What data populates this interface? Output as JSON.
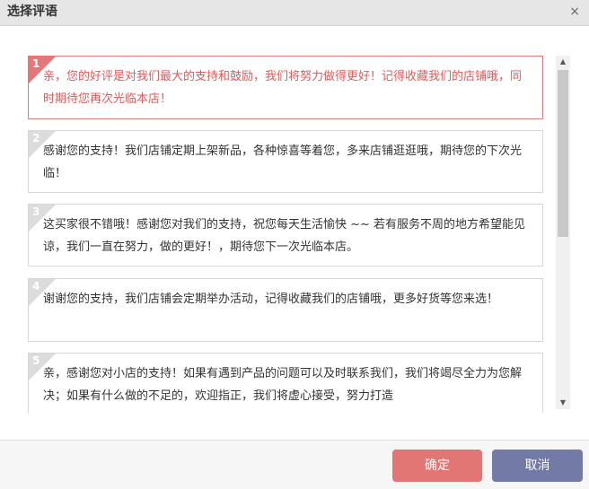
{
  "dialog": {
    "title": "选择评语",
    "close_icon": "×"
  },
  "comments": [
    {
      "num": "1",
      "text": "亲，您的好评是对我们最大的支持和鼓励，我们将努力做得更好！记得收藏我们的店铺哦，同时期待您再次光临本店！",
      "selected": true
    },
    {
      "num": "2",
      "text": "感谢您的支持！我们店铺定期上架新品，各种惊喜等着您，多来店铺逛逛哦，期待您的下次光临！",
      "selected": false
    },
    {
      "num": "3",
      "text": "这买家很不错哦！感谢您对我们的支持，祝您每天生活愉快 ~~ 若有服务不周的地方希望能见谅，我们一直在努力，做的更好！，期待您下一次光临本店。",
      "selected": false
    },
    {
      "num": "4",
      "text": "谢谢您的支持，我们店铺会定期举办活动，记得收藏我们的店铺哦，更多好货等您来选！",
      "selected": false
    },
    {
      "num": "5",
      "text": "亲，感谢您对小店的支持！如果有遇到产品的问题可以及时联系我们，我们将竭尽全力为您解决；如果有什么做的不足的，欢迎指正，我们将虚心接受，努力打造",
      "selected": false
    }
  ],
  "buttons": {
    "ok": "确定",
    "cancel": "取消"
  },
  "colors": {
    "accent_selected": "#e47777",
    "ok_button": "#e17674",
    "cancel_button": "#737aa5"
  }
}
